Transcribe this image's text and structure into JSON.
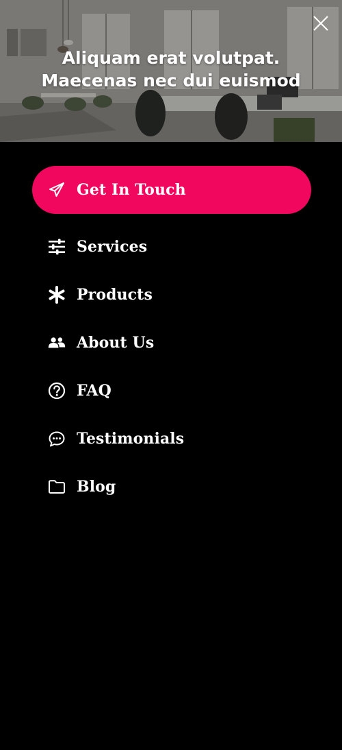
{
  "hero": {
    "title": "Aliquam erat volutpat. Maecenas nec dui euismod"
  },
  "close": {
    "icon": "close-icon"
  },
  "cta": {
    "label": "Get In Touch",
    "icon": "paper-plane-icon",
    "color": "#f2075f"
  },
  "menu": {
    "items": [
      {
        "label": "Services",
        "icon": "sliders-icon"
      },
      {
        "label": "Products",
        "icon": "asterisk-icon"
      },
      {
        "label": "About Us",
        "icon": "users-icon"
      },
      {
        "label": "FAQ",
        "icon": "question-circle-icon"
      },
      {
        "label": "Testimonials",
        "icon": "comment-dots-icon"
      },
      {
        "label": "Blog",
        "icon": "folder-icon"
      }
    ]
  }
}
